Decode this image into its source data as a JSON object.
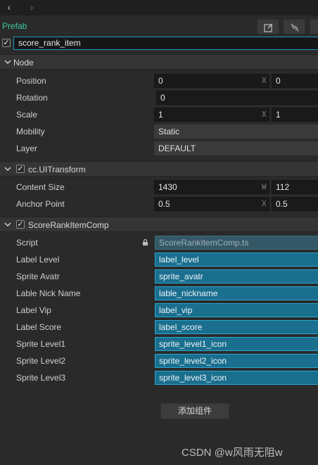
{
  "header": {
    "prefab_label": "Prefab",
    "node_name": "score_rank_item",
    "node_enabled": true
  },
  "node_section": {
    "title": "Node",
    "rows": [
      {
        "label": "Position",
        "x_value": "0",
        "x_axis": "X",
        "y_value": "0"
      },
      {
        "label": "Rotation",
        "value": "0"
      },
      {
        "label": "Scale",
        "x_value": "1",
        "x_axis": "X",
        "y_value": "1"
      },
      {
        "label": "Mobility",
        "value": "Static"
      },
      {
        "label": "Layer",
        "value": "DEFAULT"
      }
    ]
  },
  "uitransform_section": {
    "title": "cc.UITransform",
    "enabled": true,
    "rows": [
      {
        "label": "Content Size",
        "x_value": "1430",
        "x_axis": "W",
        "y_value": "112"
      },
      {
        "label": "Anchor Point",
        "x_value": "0.5",
        "x_axis": "X",
        "y_value": "0.5"
      }
    ]
  },
  "comp_section": {
    "title": "ScoreRankItemComp",
    "enabled": true,
    "script_label": "Script",
    "script_value": "ScoreRankItemComp.ts",
    "rows": [
      {
        "label": "Label Level",
        "value": "label_level"
      },
      {
        "label": "Sprite Avatr",
        "value": "sprite_avatr"
      },
      {
        "label": "Lable Nick Name",
        "value": "lable_nickname"
      },
      {
        "label": "Label Vip",
        "value": "label_vip"
      },
      {
        "label": "Label Score",
        "value": "label_score"
      },
      {
        "label": "Sprite Level1",
        "value": "sprite_level1_icon"
      },
      {
        "label": "Sprite Level2",
        "value": "sprite_level2_icon"
      },
      {
        "label": "Sprite Level3",
        "value": "sprite_level3_icon"
      }
    ]
  },
  "add_component_label": "添加组件",
  "watermark": "CSDN @w风雨无阻w",
  "colors": {
    "prefab_accent": "#3fc7a2",
    "asset_field_bg": "#1a6e8e",
    "asset_field_border": "#2aa7d1",
    "panel_bg": "#2a2a2a"
  },
  "icons": [
    "back-arrow-icon",
    "forward-arrow-icon",
    "edit-icon",
    "unlink-icon",
    "caret-down-icon",
    "checkmark-icon",
    "lock-icon"
  ]
}
